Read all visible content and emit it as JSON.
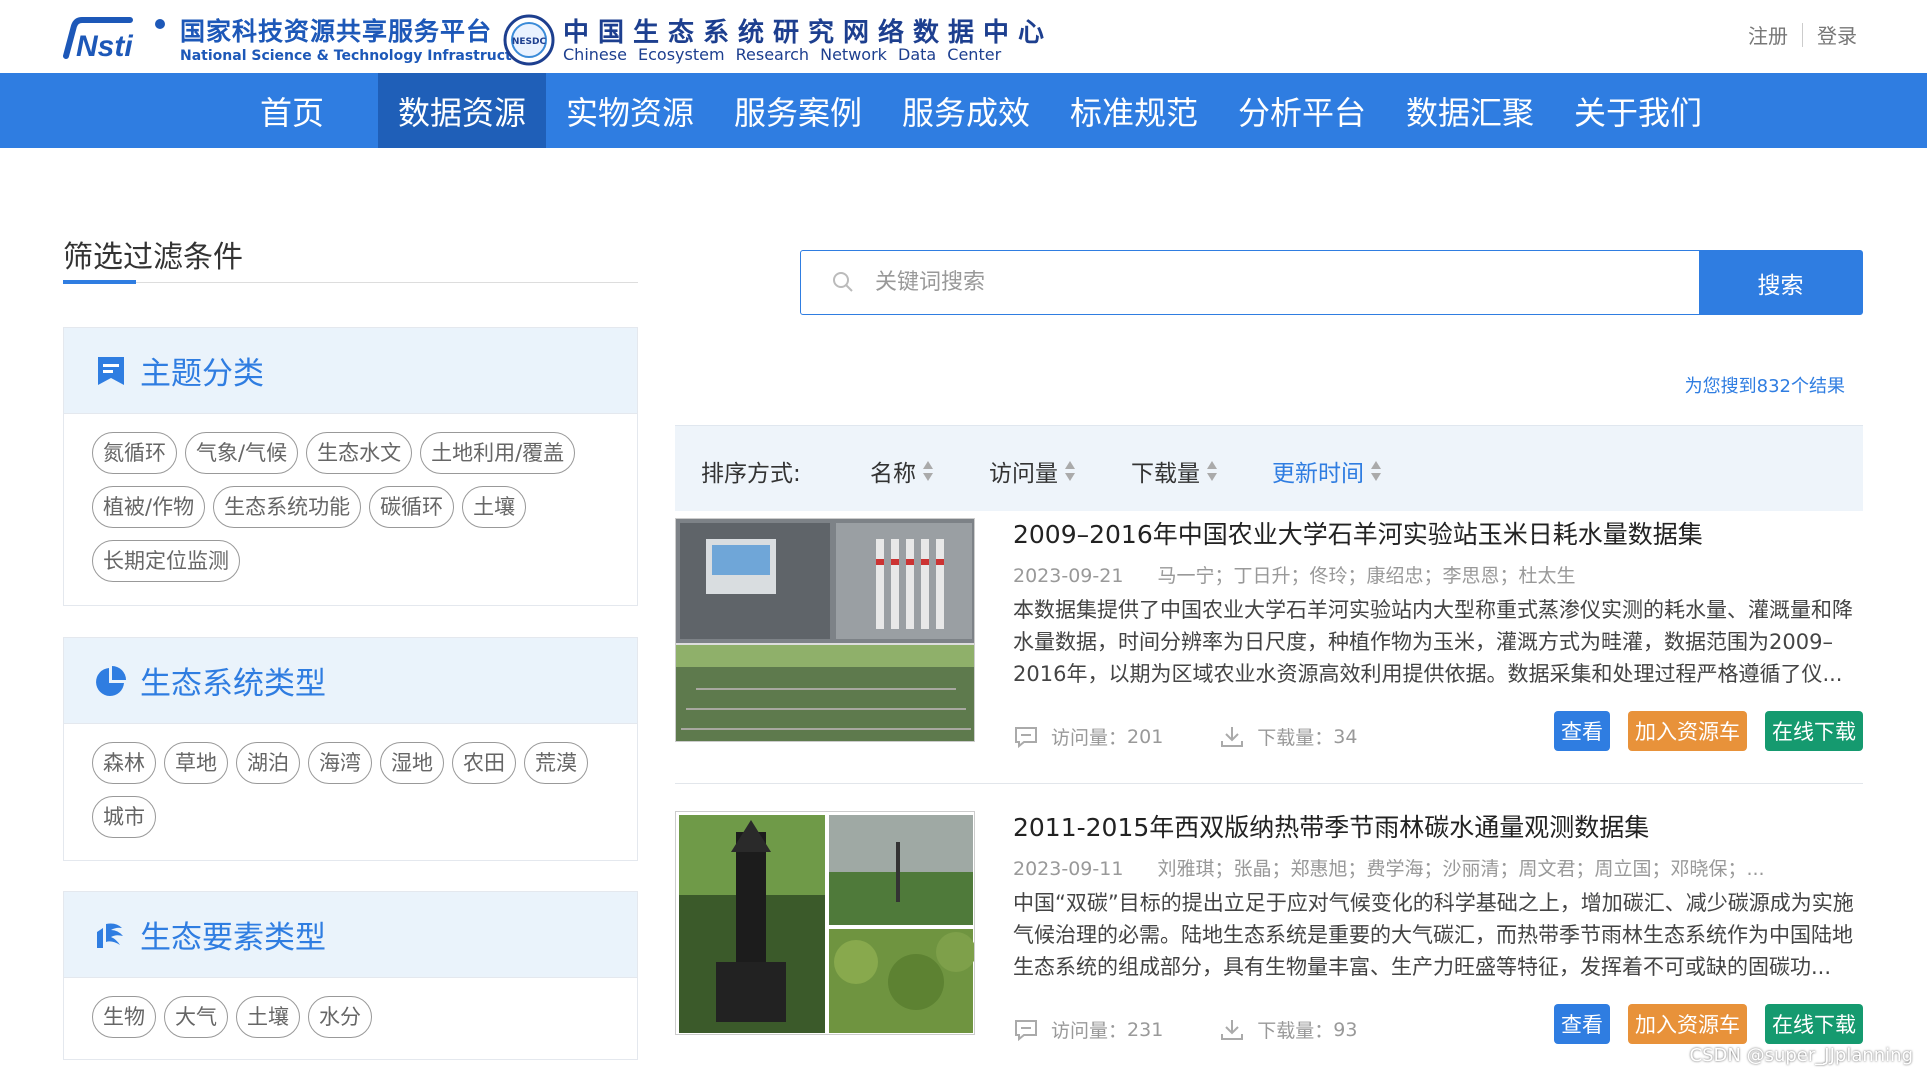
{
  "header": {
    "logo1_cn": "国家科技资源共享服务平台",
    "logo1_en": "National Science & Technology Infrastructure",
    "logo1_mark": "Nsti",
    "logo2_badge": "NESDC",
    "logo2_cn": "中国生态系统研究网络数据中心",
    "logo2_en": "Chinese Ecosystem Research Network Data Center",
    "register": "注册",
    "login": "登录"
  },
  "nav": {
    "items": [
      "首页",
      "数据资源",
      "实物资源",
      "服务案例",
      "服务成效",
      "标准规范",
      "分析平台",
      "数据汇聚",
      "关于我们"
    ],
    "active": "数据资源"
  },
  "sidebar": {
    "title": "筛选过滤条件",
    "panels": [
      {
        "title": "主题分类",
        "icon": "bookmark-icon",
        "tags": [
          "氮循环",
          "气象/气候",
          "生态水文",
          "土地利用/覆盖",
          "植被/作物",
          "生态系统功能",
          "碳循环",
          "土壤",
          "长期定位监测"
        ]
      },
      {
        "title": "生态系统类型",
        "icon": "pie-chart-icon",
        "tags": [
          "森林",
          "草地",
          "湖泊",
          "海湾",
          "湿地",
          "农田",
          "荒漠",
          "城市"
        ]
      },
      {
        "title": "生态要素类型",
        "icon": "element-icon",
        "tags": [
          "生物",
          "大气",
          "土壤",
          "水分"
        ]
      }
    ]
  },
  "search": {
    "placeholder": "关键词搜索",
    "button": "搜索",
    "result_count": "为您搜到832个结果"
  },
  "sort": {
    "label": "排序方式:",
    "options": [
      "名称",
      "访问量",
      "下载量",
      "更新时间"
    ],
    "active": "更新时间"
  },
  "results": [
    {
      "title": "2009–2016年中国农业大学石羊河实验站玉米日耗水量数据集",
      "date": "2023-09-21",
      "authors": "马一宁；丁日升；佟玲；康绍忠；李思恩；杜太生",
      "desc": "本数据集提供了中国农业大学石羊河实验站内大型称重式蒸渗仪实测的耗水量、灌溉量和降水量数据，时间分辨率为日尺度，种植作物为玉米，灌溉方式为畦灌，数据范围为2009–2016年，以期为区域农业水资源高效利用提供依据。数据采集和处理过程严格遵循了仪...",
      "visits_label": "访问量：",
      "visits": "201",
      "downloads_label": "下载量：",
      "downloads": "34",
      "btn_view": "查看",
      "btn_cart": "加入资源车",
      "btn_download": "在线下载"
    },
    {
      "title": "2011-2015年西双版纳热带季节雨林碳水通量观测数据集",
      "date": "2023-09-11",
      "authors": "刘雅琪；张晶；郑惠旭；费学海；沙丽清；周文君；周立国；邓晓保；...",
      "desc": "中国“双碳”目标的提出立足于应对气候变化的科学基础之上，增加碳汇、减少碳源成为实施气候治理的必需。陆地生态系统是重要的大气碳汇，而热带季节雨林生态系统作为中国陆地生态系统的组成部分，具有生物量丰富、生产力旺盛等特征，发挥着不可或缺的固碳功...",
      "visits_label": "访问量：",
      "visits": "231",
      "downloads_label": "下载量：",
      "downloads": "93",
      "btn_view": "查看",
      "btn_cart": "加入资源车",
      "btn_download": "在线下载"
    }
  ],
  "watermark": "CSDN @super_JJplanning",
  "colors": {
    "primary": "#2f7de1",
    "nav_active": "#1f5fb8",
    "panel_head": "#eaf3fb",
    "cart_orange": "#e8923a",
    "download_green": "#159a6f"
  }
}
